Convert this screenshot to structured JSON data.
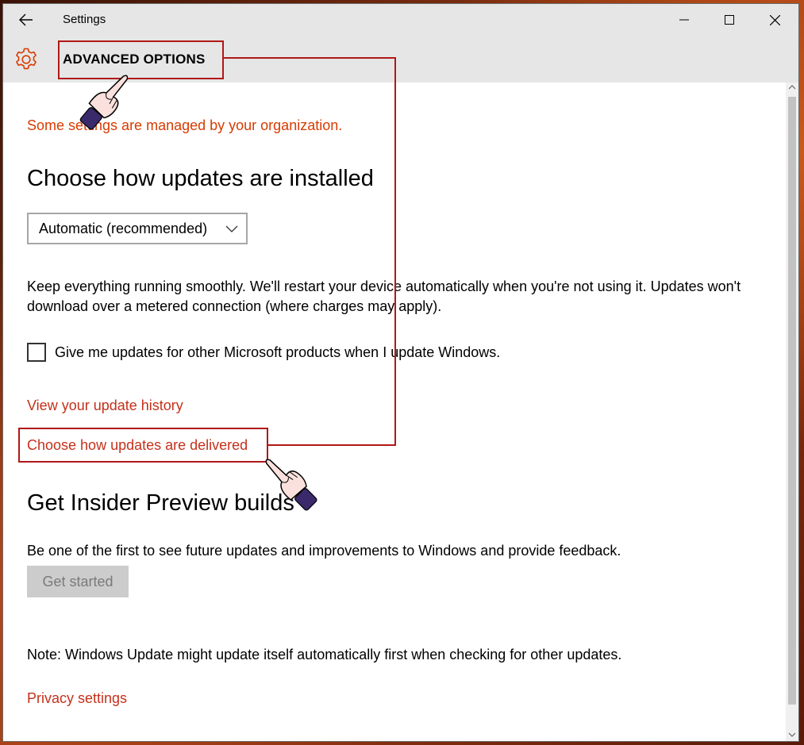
{
  "window": {
    "title": "Settings"
  },
  "header": {
    "title": "ADVANCED OPTIONS"
  },
  "content": {
    "managed_notice": "Some settings are managed by your organization.",
    "install_heading": "Choose how updates are installed",
    "install_mode": {
      "selected": "Automatic (recommended)"
    },
    "install_description": "Keep everything running smoothly. We'll restart your device automatically when you're not using it. Updates won't download over a metered connection (where charges may apply).",
    "other_products_checkbox": {
      "label": "Give me updates for other Microsoft products when I update Windows.",
      "checked": false
    },
    "links": {
      "history": "View your update history",
      "delivered": "Choose how updates are delivered",
      "privacy": "Privacy settings"
    },
    "insider": {
      "heading": "Get Insider Preview builds",
      "description": "Be one of the first to see future updates and improvements to Windows and provide feedback.",
      "button": "Get started"
    },
    "note": "Note: Windows Update might update itself automatically first when checking for other updates."
  },
  "colors": {
    "accent": "#c4311b",
    "warning": "#d83b01",
    "annotation": "#b01818",
    "titlebar": "#e6e6e6"
  },
  "icons": {
    "back": "back-arrow-icon",
    "header": "gear-icon",
    "dropdown": "chevron-down-icon",
    "pointer": "pointing-hand-icon"
  }
}
